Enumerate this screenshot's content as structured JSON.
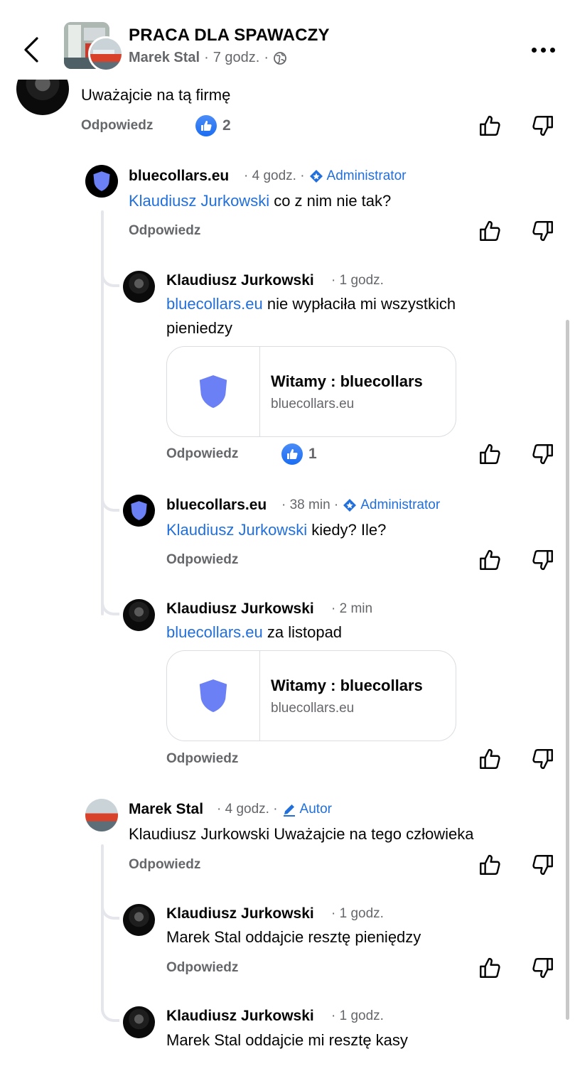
{
  "header": {
    "group_name": "PRACA DLA SPAWACZY",
    "author": "Marek Stal",
    "time": "7 godz.",
    "separator": "·"
  },
  "comments": [
    {
      "id": "c0",
      "text": "Uważajcie na tą firmę",
      "reply_label": "Odpowiedz",
      "like_count": "2"
    },
    {
      "id": "c1",
      "name": "bluecollars.eu",
      "time": "· 4 godz. ·",
      "badge": "Administrator",
      "mention": "Klaudiusz Jurkowski",
      "text": " co z nim nie tak?",
      "reply_label": "Odpowiedz"
    },
    {
      "id": "c2",
      "name": "Klaudiusz Jurkowski",
      "time": "· 1 godz.",
      "mention": "bluecollars.eu",
      "text": " nie wypłaciła mi wszystkich pieniedzy",
      "link_title": "Witamy : bluecollars",
      "link_domain": "bluecollars.eu",
      "reply_label": "Odpowiedz",
      "like_count": "1"
    },
    {
      "id": "c3",
      "name": "bluecollars.eu",
      "time": "· 38 min ·",
      "badge": "Administrator",
      "mention": "Klaudiusz Jurkowski",
      "text": " kiedy? Ile?",
      "reply_label": "Odpowiedz"
    },
    {
      "id": "c4",
      "name": "Klaudiusz Jurkowski",
      "time": "· 2 min",
      "mention": "bluecollars.eu",
      "text": " za listopad",
      "link_title": "Witamy : bluecollars",
      "link_domain": "bluecollars.eu",
      "reply_label": "Odpowiedz"
    },
    {
      "id": "c5",
      "name": "Marek Stal",
      "time": "· 4 godz. ·",
      "badge": "Autor",
      "text": "Klaudiusz Jurkowski Uważajcie na tego człowieka",
      "reply_label": "Odpowiedz"
    },
    {
      "id": "c6",
      "name": "Klaudiusz Jurkowski",
      "time": "· 1 godz.",
      "text": "Marek Stal oddajcie resztę pieniędzy",
      "reply_label": "Odpowiedz"
    },
    {
      "id": "c7",
      "name": "Klaudiusz Jurkowski",
      "time": "· 1 godz.",
      "text": "Marek Stal oddajcie mi resztę kasy"
    }
  ],
  "icons": {
    "back": "chevron-left-icon",
    "globe": "globe-icon",
    "more": "more-horizontal-icon",
    "upvote": "thumb-up-outline-icon",
    "downvote": "thumb-down-outline-icon",
    "like": "like-icon",
    "admin": "admin-diamond-icon",
    "author": "pencil-icon"
  },
  "colors": {
    "link": "#216fdb",
    "secondary_text": "#65676b",
    "shield": "#6b80f5",
    "like": "#1b6ef2"
  }
}
